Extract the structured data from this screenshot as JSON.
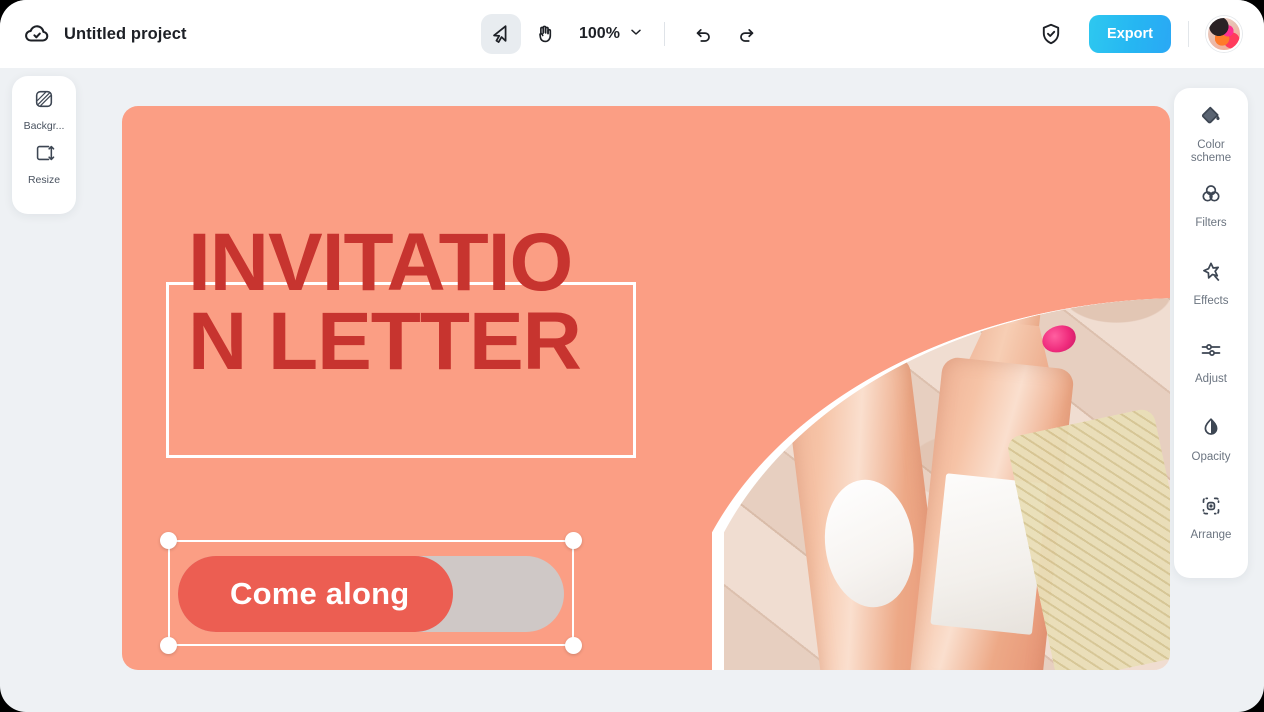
{
  "app": {
    "background_color": "#eef1f4",
    "window_radius_px": 26
  },
  "topbar": {
    "cloud_icon": "cloud-check-icon",
    "project_title": "Untitled project",
    "tools": [
      {
        "name": "select-tool",
        "icon": "cursor-arrow-icon",
        "active": true
      },
      {
        "name": "hand-tool",
        "icon": "hand-icon",
        "active": false
      }
    ],
    "zoom": {
      "value": "100%",
      "chevron_icon": "chevron-down-icon"
    },
    "history": [
      {
        "name": "undo-button",
        "icon": "undo-arrow-icon"
      },
      {
        "name": "redo-button",
        "icon": "redo-arrow-icon"
      }
    ],
    "shield_icon": "shield-check-icon",
    "export_label": "Export",
    "export_gradient": [
      "#2ec8f0",
      "#2aa8f5"
    ],
    "avatar": "user-avatar"
  },
  "left_panel": {
    "items": [
      {
        "label": "Backgr...",
        "icon": "background-pattern-icon"
      },
      {
        "label": "Resize",
        "icon": "resize-frame-icon"
      }
    ]
  },
  "right_panel": {
    "items": [
      {
        "label": "Color\nscheme",
        "label_line1": "Color",
        "label_line2": "scheme",
        "icon": "paint-bucket-icon"
      },
      {
        "label": "Filters",
        "icon": "filters-circles-icon"
      },
      {
        "label": "Effects",
        "icon": "effects-star-icon"
      },
      {
        "label": "Adjust",
        "icon": "adjust-sliders-icon"
      },
      {
        "label": "Opacity",
        "icon": "opacity-droplet-icon"
      },
      {
        "label": "Arrange",
        "icon": "arrange-frame-icon"
      }
    ]
  },
  "canvas": {
    "background_color": "#fb9e84",
    "heading_text": "INVITATION LETTER",
    "heading_color": "#c7342f",
    "frame_color": "#ffffff",
    "cta": {
      "label": "Come along",
      "fill_color": "#ec5e52",
      "track_color": "#cfc8c6",
      "text_color": "#ffffff",
      "selected": true,
      "handles": 4
    },
    "photo": {
      "description": "two rose wine bottles on beige tile with pink flowers",
      "shape": "arch"
    }
  }
}
